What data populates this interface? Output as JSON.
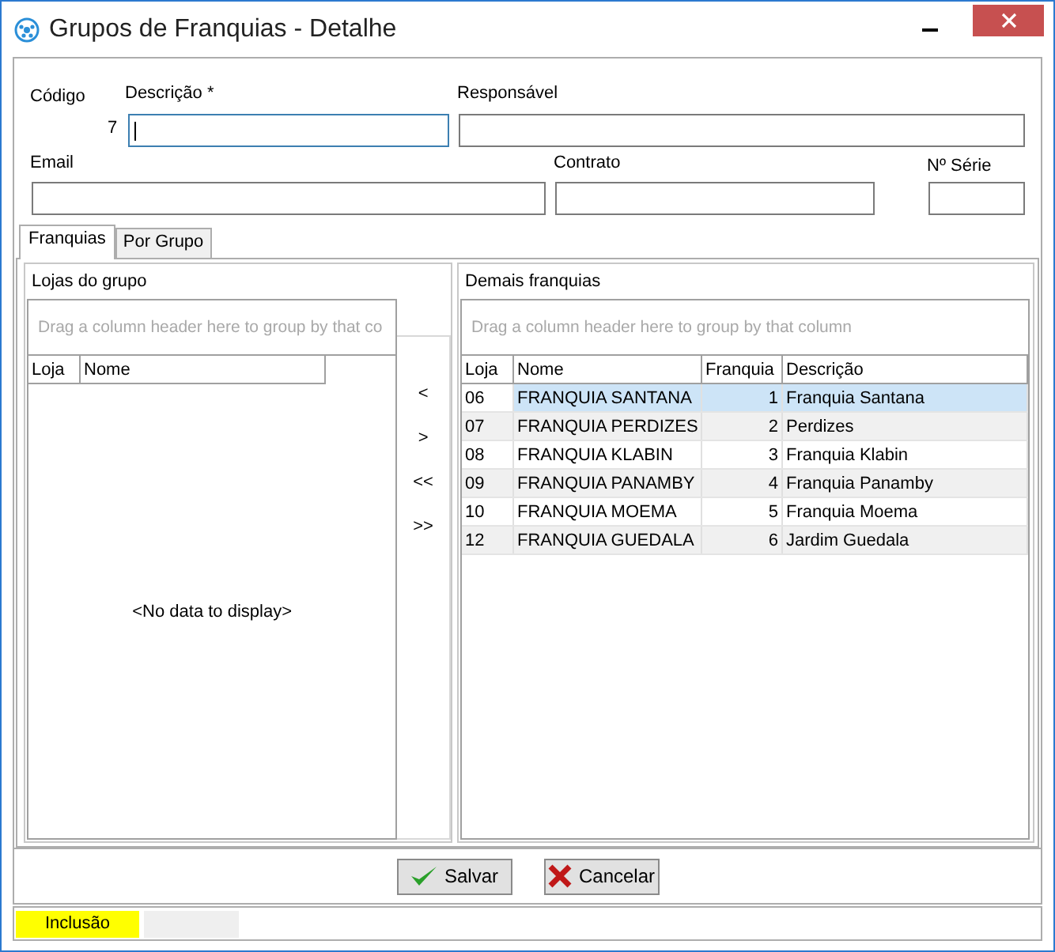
{
  "window": {
    "title": "Grupos de Franquias - Detalhe"
  },
  "form": {
    "codigo": {
      "label": "Código",
      "value": "7"
    },
    "descricao": {
      "label": "Descrição *",
      "focused": true
    },
    "responsavel": {
      "label": "Responsável",
      "focused": false
    },
    "email": {
      "label": "Email",
      "focused": false
    },
    "contrato": {
      "label": "Contrato",
      "focused": false
    },
    "serie": {
      "label": "Nº Série",
      "focused": false
    }
  },
  "tabs": [
    {
      "label": "Franquias",
      "selected": true
    },
    {
      "label": "Por Grupo",
      "selected": false
    }
  ],
  "left_panel": {
    "title": "Lojas do grupo",
    "group_hint": "Drag a column header here to group by that co",
    "columns": [
      "Loja",
      "Nome"
    ],
    "empty_text": "<No data to display>"
  },
  "move_buttons": [
    "<",
    ">",
    "<<",
    ">>"
  ],
  "right_panel": {
    "title": "Demais franquias",
    "group_hint": "Drag a column header here to group by that column",
    "columns": [
      "Loja",
      "Nome",
      "Franquia",
      "Descrição"
    ],
    "rows": [
      {
        "loja": "06",
        "nome": "FRANQUIA SANTANA",
        "franquia": "1",
        "descricao": "Franquia Santana",
        "selected": true
      },
      {
        "loja": "07",
        "nome": "FRANQUIA PERDIZES",
        "franquia": "2",
        "descricao": "Perdizes",
        "selected": false
      },
      {
        "loja": "08",
        "nome": "FRANQUIA KLABIN",
        "franquia": "3",
        "descricao": "Franquia Klabin",
        "selected": false
      },
      {
        "loja": "09",
        "nome": "FRANQUIA PANAMBY",
        "franquia": "4",
        "descricao": "Franquia Panamby",
        "selected": false
      },
      {
        "loja": "10",
        "nome": "FRANQUIA MOEMA",
        "franquia": "5",
        "descricao": "Franquia Moema",
        "selected": false
      },
      {
        "loja": "12",
        "nome": "FRANQUIA GUEDALA",
        "franquia": "6",
        "descricao": "Jardim Guedala",
        "selected": false
      }
    ]
  },
  "buttons": [
    {
      "label": "Salvar",
      "kind": "save"
    },
    {
      "label": "Cancelar",
      "kind": "cancel"
    }
  ],
  "status_bar": {
    "mode": "Inclusão"
  }
}
